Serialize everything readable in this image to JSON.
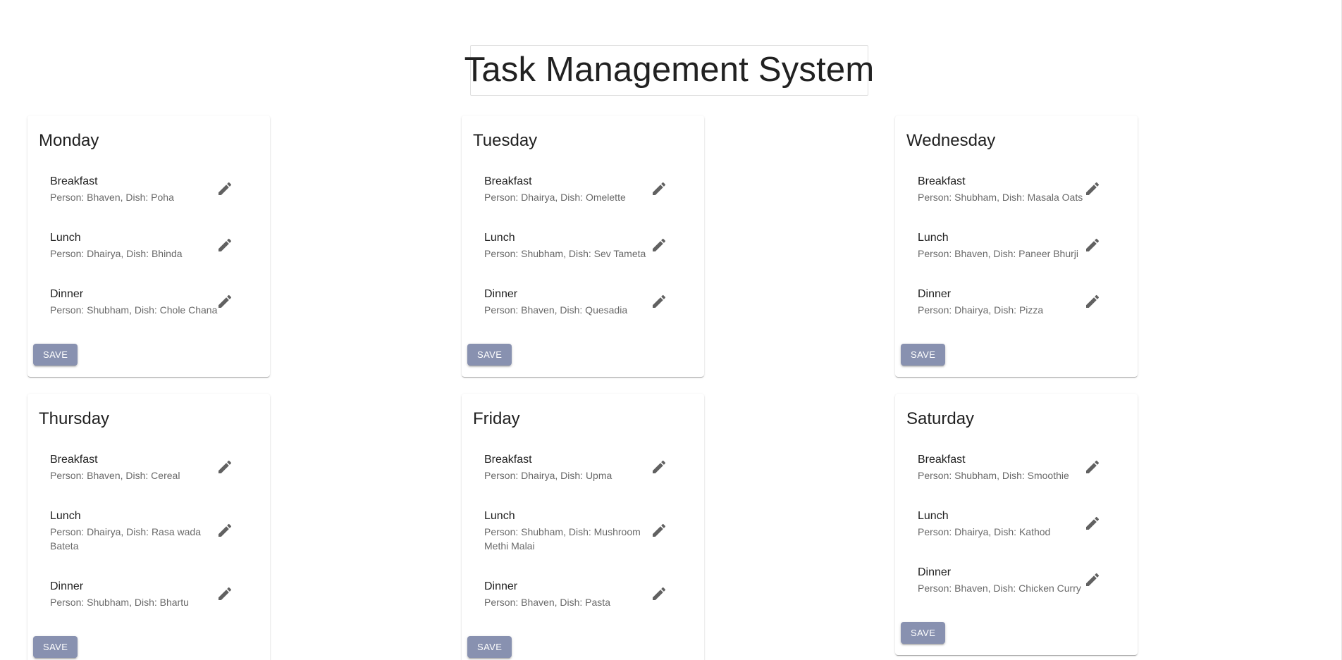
{
  "page": {
    "title": "Task Management System"
  },
  "days": [
    {
      "name": "Monday",
      "save_label": "SAVE",
      "meals": [
        {
          "meal": "Breakfast",
          "detail": "Person: Bhaven, Dish: Poha"
        },
        {
          "meal": "Lunch",
          "detail": "Person: Dhairya, Dish: Bhinda"
        },
        {
          "meal": "Dinner",
          "detail": "Person: Shubham, Dish: Chole Chana"
        }
      ]
    },
    {
      "name": "Tuesday",
      "save_label": "SAVE",
      "meals": [
        {
          "meal": "Breakfast",
          "detail": "Person: Dhairya, Dish: Omelette"
        },
        {
          "meal": "Lunch",
          "detail": "Person: Shubham, Dish: Sev Tameta"
        },
        {
          "meal": "Dinner",
          "detail": "Person: Bhaven, Dish: Quesadia"
        }
      ]
    },
    {
      "name": "Wednesday",
      "save_label": "SAVE",
      "meals": [
        {
          "meal": "Breakfast",
          "detail": "Person: Shubham, Dish: Masala Oats"
        },
        {
          "meal": "Lunch",
          "detail": "Person: Bhaven, Dish: Paneer Bhurji"
        },
        {
          "meal": "Dinner",
          "detail": "Person: Dhairya, Dish: Pizza"
        }
      ]
    },
    {
      "name": "Thursday",
      "save_label": "SAVE",
      "meals": [
        {
          "meal": "Breakfast",
          "detail": "Person: Bhaven, Dish: Cereal"
        },
        {
          "meal": "Lunch",
          "detail": "Person: Dhairya, Dish: Rasa wada Bateta"
        },
        {
          "meal": "Dinner",
          "detail": "Person: Shubham, Dish: Bhartu"
        }
      ]
    },
    {
      "name": "Friday",
      "save_label": "SAVE",
      "meals": [
        {
          "meal": "Breakfast",
          "detail": "Person: Dhairya, Dish: Upma"
        },
        {
          "meal": "Lunch",
          "detail": "Person: Shubham, Dish: Mushroom Methi Malai"
        },
        {
          "meal": "Dinner",
          "detail": "Person: Bhaven, Dish: Pasta"
        }
      ]
    },
    {
      "name": "Saturday",
      "save_label": "SAVE",
      "meals": [
        {
          "meal": "Breakfast",
          "detail": "Person: Shubham, Dish: Smoothie"
        },
        {
          "meal": "Lunch",
          "detail": "Person: Dhairya, Dish: Kathod"
        },
        {
          "meal": "Dinner",
          "detail": "Person: Bhaven, Dish: Chicken Curry"
        }
      ]
    }
  ],
  "icons": {
    "edit": "pencil-edit-icon"
  },
  "colors": {
    "save_button": "#8891b0",
    "edit_icon": "#616161"
  }
}
